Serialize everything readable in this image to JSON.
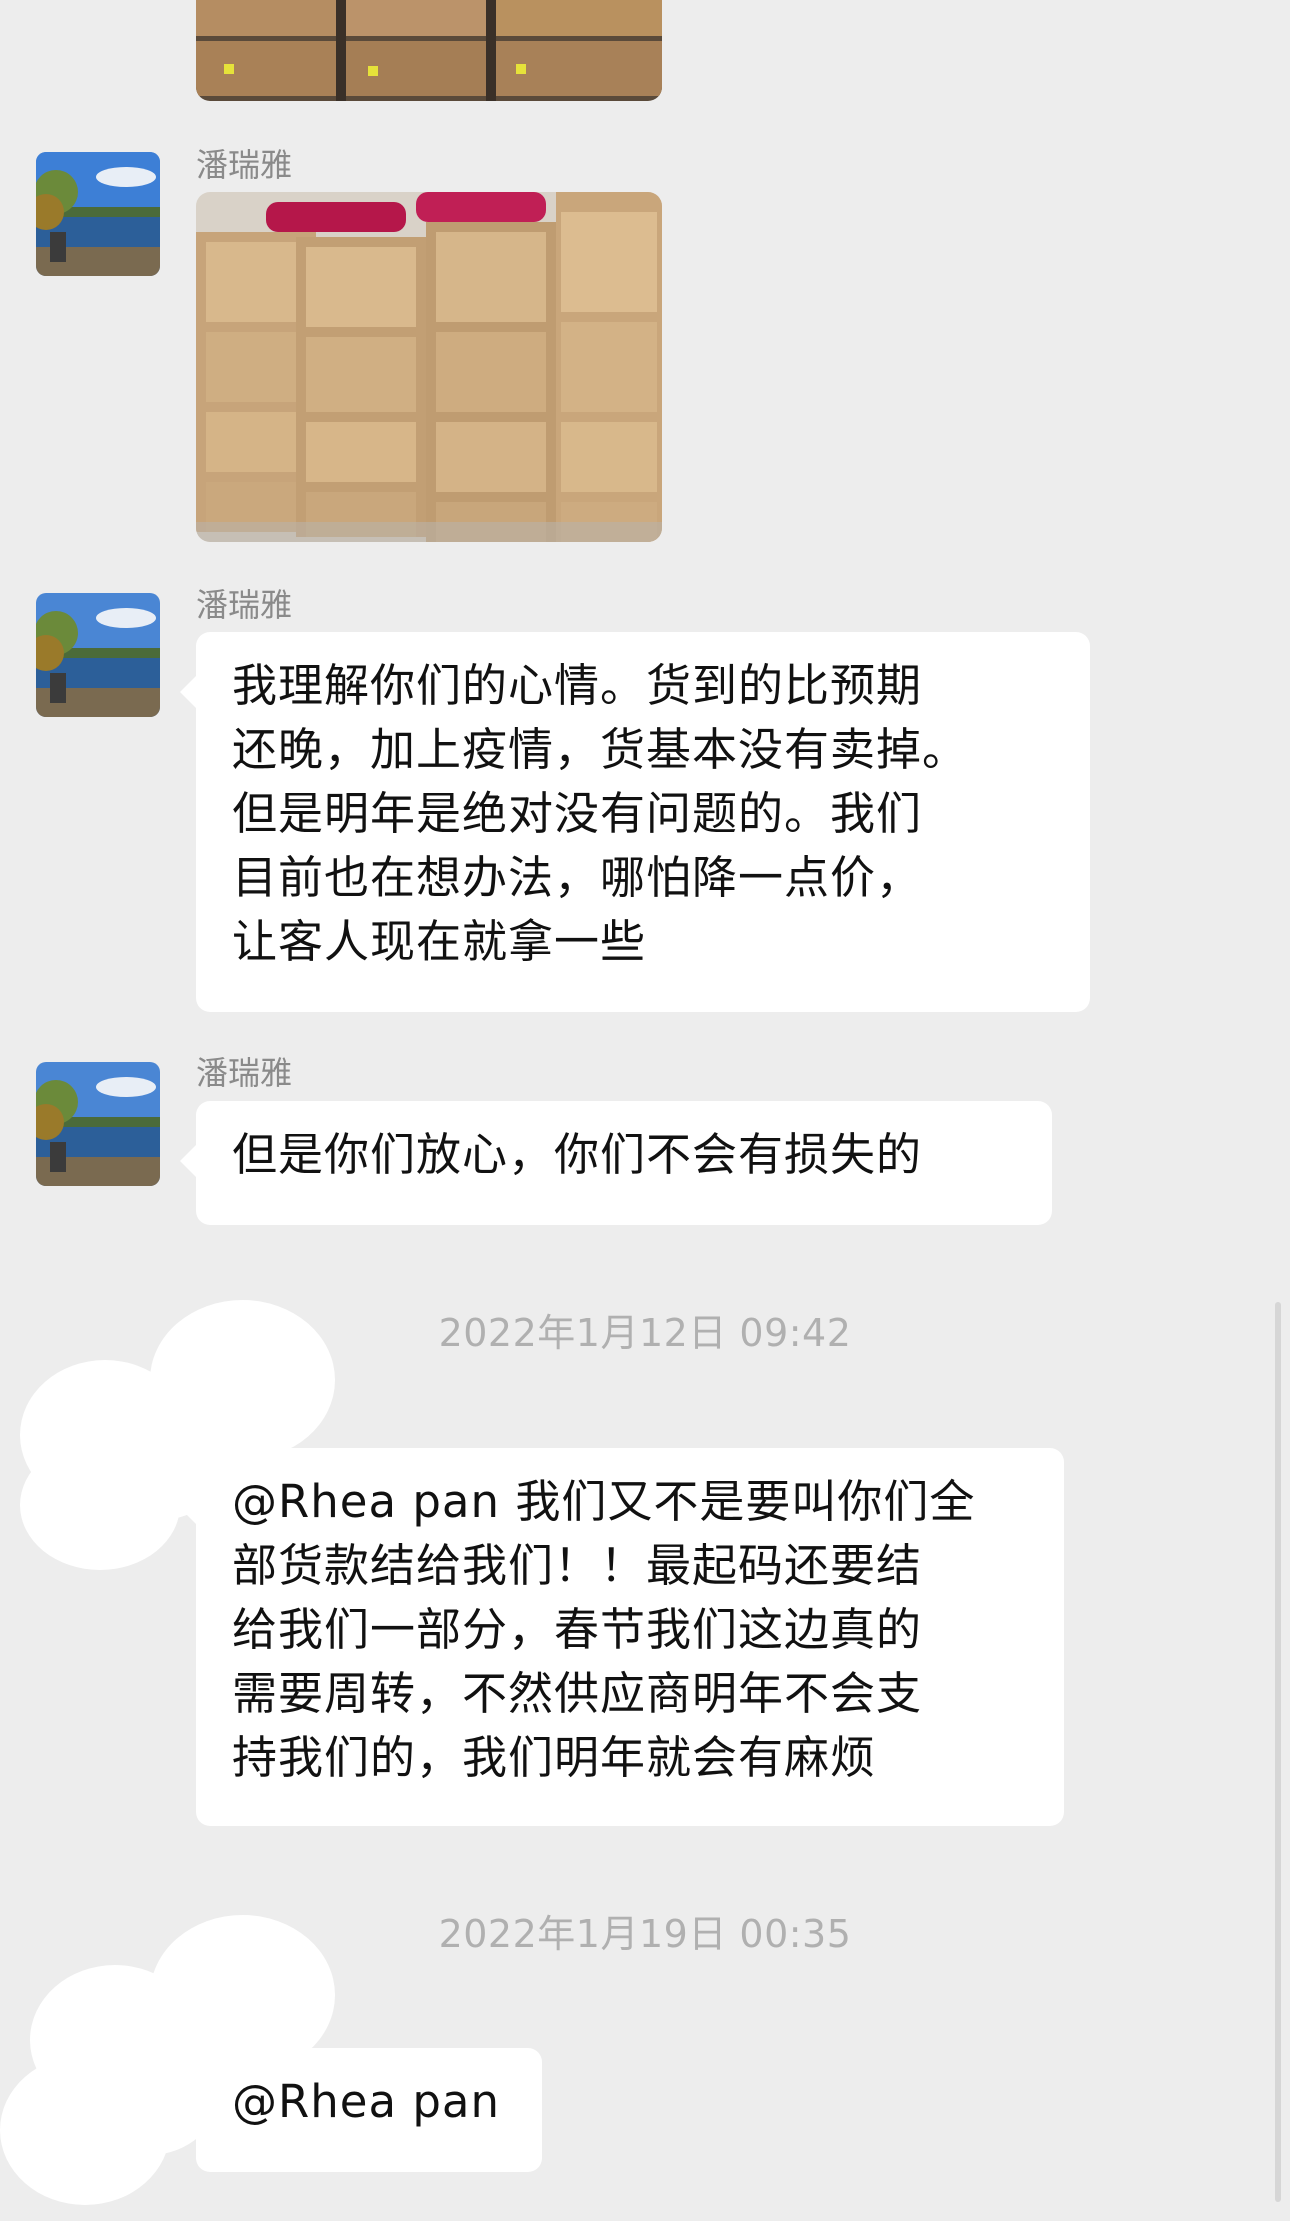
{
  "chat": {
    "messages": [
      {
        "sender": "潘瑞雅",
        "type": "image"
      },
      {
        "sender": "潘瑞雅",
        "type": "text",
        "lines": [
          "我理解你们的心情。货到的比预期",
          "还晚，加上疫情，货基本没有卖掉。",
          "但是明年是绝对没有问题的。我们",
          "目前也在想办法，哪怕降一点价，",
          "让客人现在就拿一些"
        ]
      },
      {
        "sender": "潘瑞雅",
        "type": "text",
        "lines": [
          "但是你们放心，你们不会有损失的"
        ]
      },
      {
        "sender": "",
        "type": "text",
        "lines": [
          "@Rhea pan 我们又不是要叫你们全",
          "部货款结给我们！！最起码还要结",
          "给我们一部分，春节我们这边真的",
          "需要周转，不然供应商明年不会支",
          "持我们的，我们明年就会有麻烦"
        ]
      },
      {
        "sender": "",
        "type": "text",
        "lines": [
          "@Rhea pan"
        ]
      }
    ],
    "timestamps": [
      "2022年1月12日 09:42",
      "2022年1月19日 00:35"
    ]
  },
  "colors": {
    "background": "#ededed",
    "bubble": "#ffffff",
    "timestamp": "#b0b0b0",
    "sender_name": "#8a8a8a"
  },
  "icons": [
    "avatar-lake-photo",
    "redacted-avatar-blob"
  ]
}
